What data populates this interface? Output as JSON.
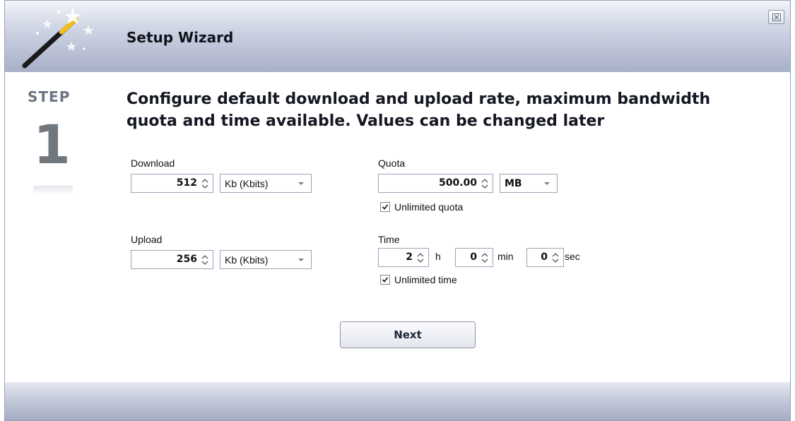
{
  "window": {
    "title": "Setup Wizard",
    "close_icon": "close-icon"
  },
  "step": {
    "label": "STEP",
    "number": "1"
  },
  "heading": "Configure default download and upload rate, maximum bandwidth quota  and time available. Values can be changed later",
  "download": {
    "label": "Download",
    "value": "512",
    "unit": "Kb (Kbits)"
  },
  "upload": {
    "label": "Upload",
    "value": "256",
    "unit": "Kb (Kbits)"
  },
  "quota": {
    "label": "Quota",
    "value": "500.00",
    "unit": "MB",
    "unlimited_label": "Unlimited quota",
    "unlimited_checked": true
  },
  "time": {
    "label": "Time",
    "hours": "2",
    "hours_unit": "h",
    "minutes": "0",
    "minutes_unit": "min",
    "seconds": "0",
    "seconds_unit": "sec",
    "unlimited_label": "Unlimited time",
    "unlimited_checked": true
  },
  "buttons": {
    "next": "Next"
  },
  "colors": {
    "header_gradient_top": "#f2f4f9",
    "header_gradient_bottom": "#a8b0c8",
    "step_gray": "#6c7382"
  }
}
